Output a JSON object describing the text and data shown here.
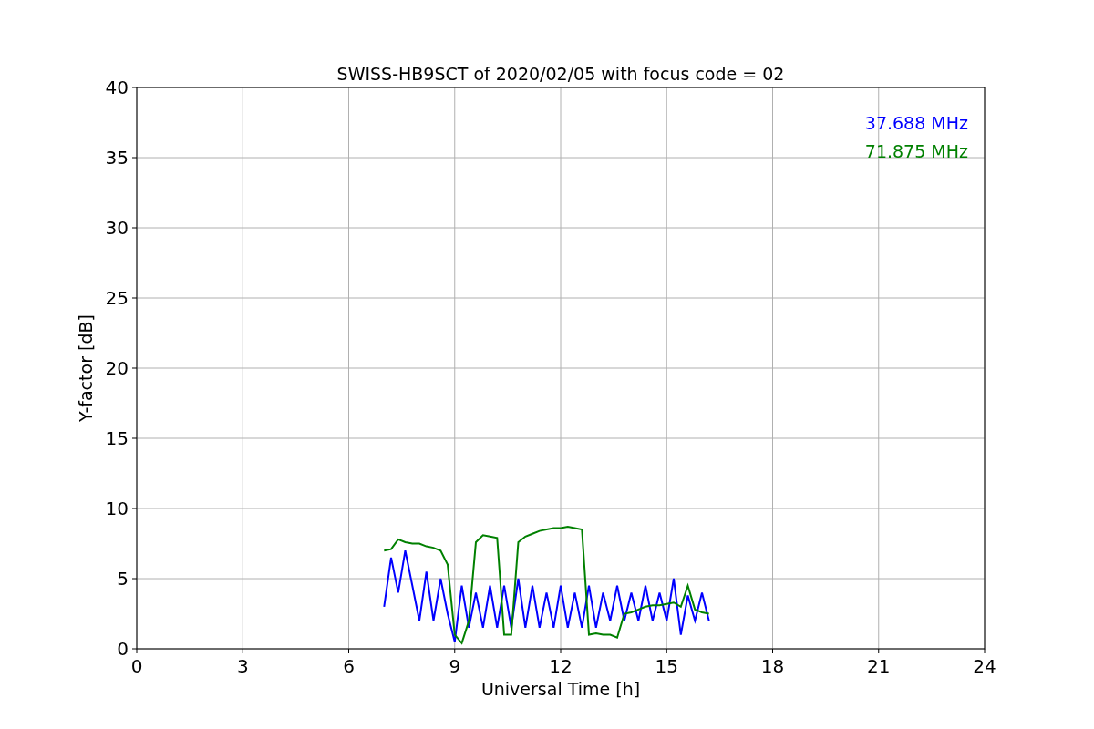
{
  "chart_data": {
    "type": "line",
    "title": "SWISS-HB9SCT of 2020/02/05 with focus code = 02",
    "xlabel": "Universal Time [h]",
    "ylabel": "Y-factor [dB]",
    "x": [
      7.0,
      7.2,
      7.4,
      7.6,
      7.8,
      8.0,
      8.2,
      8.4,
      8.6,
      8.8,
      9.0,
      9.2,
      9.4,
      9.6,
      9.8,
      10.0,
      10.2,
      10.4,
      10.6,
      10.8,
      11.0,
      11.2,
      11.4,
      11.6,
      11.8,
      12.0,
      12.2,
      12.4,
      12.6,
      12.8,
      13.0,
      13.2,
      13.4,
      13.6,
      13.8,
      14.0,
      14.2,
      14.4,
      14.6,
      14.8,
      15.0,
      15.2,
      15.4,
      15.6,
      15.8,
      16.0,
      16.2
    ],
    "series": [
      {
        "name": "37.688 MHz",
        "color": "#0000ff",
        "values": [
          3,
          6.5,
          4,
          7,
          4.5,
          2,
          5.5,
          2,
          5,
          2.5,
          0.5,
          4.5,
          1.5,
          4,
          1.5,
          4.5,
          1.5,
          4.5,
          1.5,
          5,
          1.5,
          4.5,
          1.5,
          4,
          1.5,
          4.5,
          1.5,
          4,
          1.5,
          4.5,
          1.5,
          4,
          2,
          4.5,
          2,
          4,
          2,
          4.5,
          2,
          4,
          2,
          5,
          1,
          3.8,
          2,
          4,
          2
        ]
      },
      {
        "name": "71.875 MHz",
        "color": "#008000",
        "values": [
          7.0,
          7.1,
          7.8,
          7.6,
          7.5,
          7.5,
          7.3,
          7.2,
          7.0,
          6.0,
          1.0,
          0.4,
          2.0,
          7.6,
          8.1,
          8.0,
          7.9,
          1.0,
          1.0,
          7.6,
          8.0,
          8.2,
          8.4,
          8.5,
          8.6,
          8.6,
          8.7,
          8.6,
          8.5,
          1.0,
          1.1,
          1.0,
          1.0,
          0.8,
          2.5,
          2.6,
          2.8,
          3.0,
          3.1,
          3.1,
          3.2,
          3.3,
          3.0,
          4.5,
          2.8,
          2.6,
          2.5
        ]
      }
    ],
    "xlim": [
      0,
      24
    ],
    "ylim": [
      0,
      40
    ],
    "xticks": [
      0,
      3,
      6,
      9,
      12,
      15,
      18,
      21,
      24
    ],
    "yticks": [
      0,
      5,
      10,
      15,
      20,
      25,
      30,
      35,
      40
    ],
    "grid": true
  }
}
